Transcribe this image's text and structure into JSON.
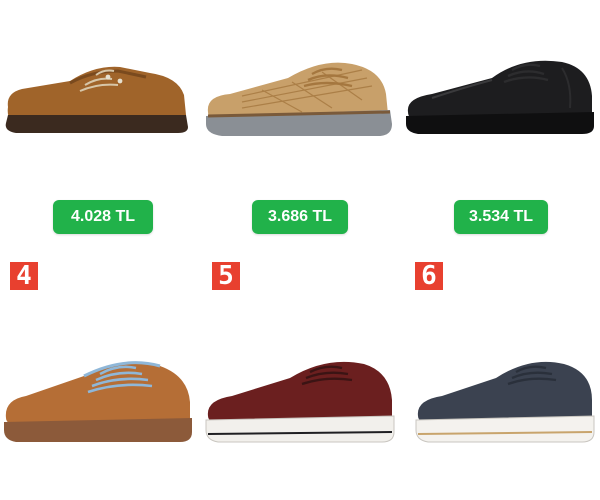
{
  "products": [
    {
      "price": "4.028 TL",
      "rank": null,
      "shoe_icon": "brown-boat-shoe-icon",
      "colors": {
        "upper": "#a0642a",
        "sole": "#3b2a1f",
        "lace": "#d7c6a8"
      }
    },
    {
      "price": "3.686 TL",
      "rank": null,
      "shoe_icon": "tan-mesh-sneaker-icon",
      "colors": {
        "upper": "#c8a06a",
        "sole": "#8a8f95",
        "lace": "#a5773f"
      }
    },
    {
      "price": "3.534 TL",
      "rank": null,
      "shoe_icon": "black-leather-sneaker-icon",
      "colors": {
        "upper": "#1d1d1f",
        "sole": "#0f0f10",
        "lace": "#2c2c2e"
      }
    },
    {
      "price": null,
      "rank": "4",
      "shoe_icon": "suede-sneaker-icon",
      "colors": {
        "upper": "#b56e36",
        "sole": "#8c5a3a",
        "lace": "#8fb7d8"
      }
    },
    {
      "price": null,
      "rank": "5",
      "shoe_icon": "burgundy-sneaker-icon",
      "colors": {
        "upper": "#6b1f1f",
        "sole": "#f2f0ec",
        "lace": "#3b1414"
      }
    },
    {
      "price": null,
      "rank": "6",
      "shoe_icon": "navy-sneaker-icon",
      "colors": {
        "upper": "#3b4250",
        "sole": "#f4f2ee",
        "lace": "#2a303b"
      }
    }
  ],
  "accent": "#21b24a",
  "rank_badge_color": "#e8402f"
}
